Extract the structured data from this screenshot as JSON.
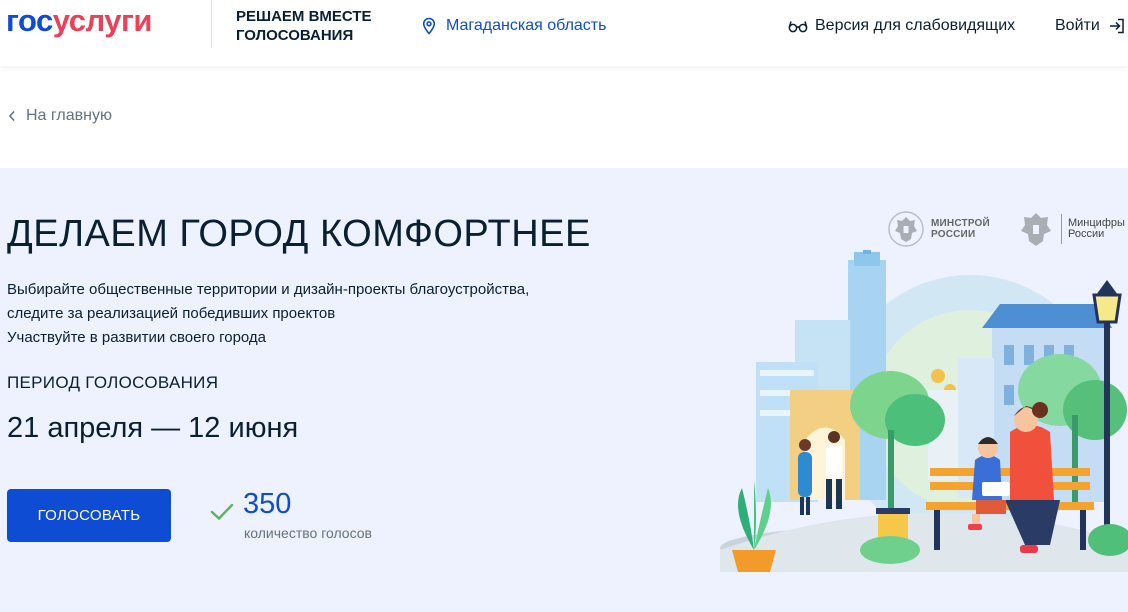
{
  "header": {
    "logo_gos": "гос",
    "logo_uslugi": "услуги",
    "project_name": "РЕШАЕМ ВМЕСТЕ ГОЛОСОВАНИЯ",
    "region": "Магаданская область",
    "accessibility": "Версия для слабовидящих",
    "login": "Войти"
  },
  "breadcrumb": {
    "back_label": "На главную"
  },
  "hero": {
    "title": "ДЕЛАЕМ ГОРОД КОМФОРТНЕЕ",
    "description_line1": "Выбирайте общественные территории и дизайн-проекты благоустройства,",
    "description_line2": "следите за реализацией победивших проектов",
    "description_line3": "Участвуйте в развитии своего города",
    "period_label": "ПЕРИОД ГОЛОСОВАНИЯ",
    "period_dates": "21 апреля — 12 июня",
    "vote_button": "ГОЛОСОВАТЬ",
    "votes_count": "350",
    "votes_label": "количество голосов"
  },
  "partners": {
    "minstroy_line1": "МИНСТРОЙ",
    "minstroy_line2": "РОССИИ",
    "mincifry_line1": "Минцифры",
    "mincifry_line2": "России"
  },
  "colors": {
    "brand_blue": "#0d4cd3",
    "brand_red": "#ee3f58",
    "hero_background": "#edf2fe",
    "check_green": "#5ab45a"
  },
  "icons": {
    "region": "location-pin-icon",
    "accessibility": "glasses-icon",
    "login": "login-arrow-icon",
    "back": "chevron-left-icon",
    "votes": "checkmark-icon"
  }
}
